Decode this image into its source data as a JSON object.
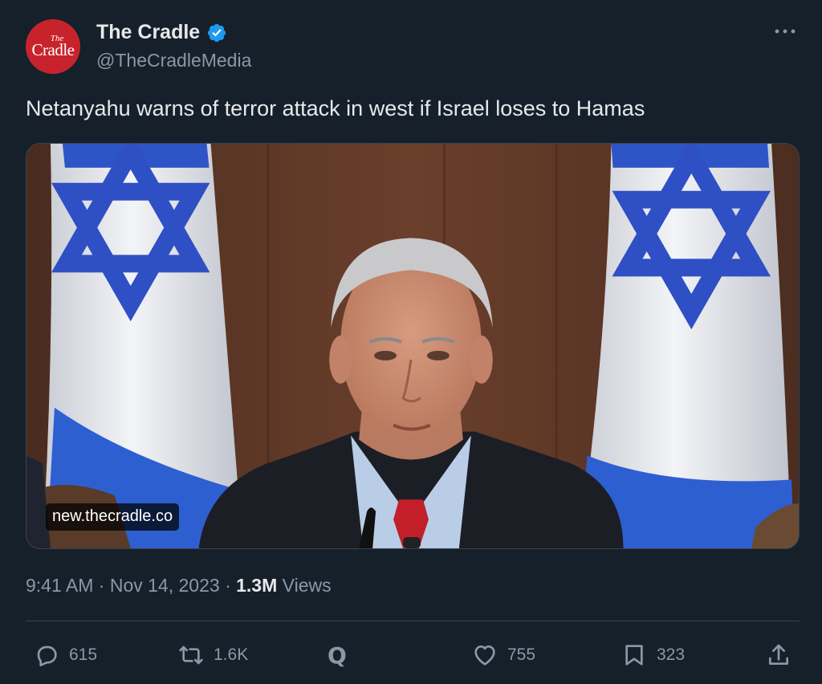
{
  "author": {
    "display_name": "The Cradle",
    "handle": "@TheCradleMedia",
    "avatar_text_small": "The",
    "avatar_text_big": "Cradle",
    "verified": true
  },
  "tweet": {
    "text": "Netanyahu warns of terror attack in west if Israel loses to Hamas"
  },
  "media": {
    "link_label": "new.thecradle.co"
  },
  "meta": {
    "time": "9:41 AM",
    "separator": "·",
    "date": "Nov 14, 2023",
    "views_count": "1.3M",
    "views_label": "Views"
  },
  "actions": {
    "replies": "615",
    "retweets": "1.6K",
    "grok_label": "Q",
    "likes": "755",
    "bookmarks": "323"
  },
  "colors": {
    "background": "#15202b",
    "primary_text": "#e7e9ea",
    "secondary_text": "#8b98a5",
    "verified_blue": "#1d9bf0",
    "divider": "#38444d",
    "avatar_red": "#c8232c"
  },
  "icons": {
    "more": "more-horizontal-icon",
    "verified": "verified-badge-icon",
    "reply": "reply-icon",
    "retweet": "retweet-icon",
    "grok": "grok-icon",
    "like": "heart-icon",
    "bookmark": "bookmark-icon",
    "share": "share-icon"
  }
}
